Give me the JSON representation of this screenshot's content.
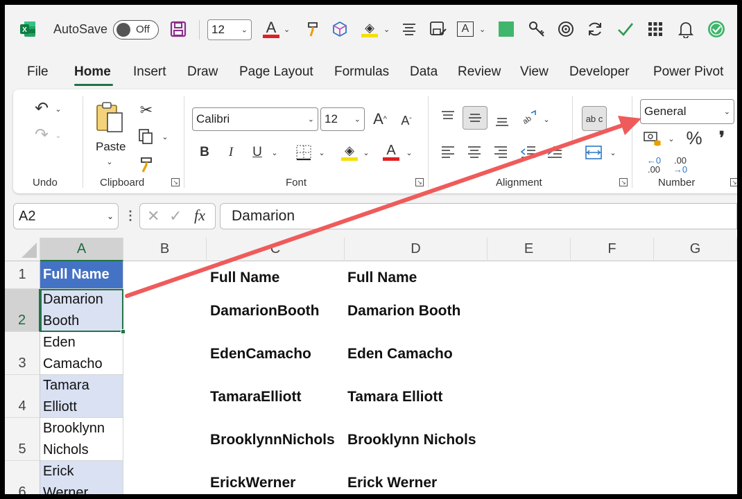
{
  "qat": {
    "autosave_label": "AutoSave",
    "autosave_state": "Off",
    "font_size": "12",
    "font_color": "#e02020",
    "highlight_color": "#f5e000"
  },
  "tabs": [
    "File",
    "Home",
    "Insert",
    "Draw",
    "Page Layout",
    "Formulas",
    "Data",
    "Review",
    "View",
    "Developer",
    "Power Pivot"
  ],
  "ribbon": {
    "groups": {
      "undo": "Undo",
      "clipboard": "Clipboard",
      "font": "Font",
      "alignment": "Alignment",
      "number": "Number"
    },
    "paste_label": "Paste",
    "font_name": "Calibri",
    "font_size": "12",
    "number_format": "General",
    "bold": "B",
    "italic": "I",
    "underline": "U",
    "percent": "%",
    "comma": "❜",
    "inc_decimal_top": "←0",
    "inc_decimal_bottom": ".00",
    "dec_decimal_top": ".00",
    "dec_decimal_bottom": "→0",
    "wrap_text": "ab c"
  },
  "formula_bar": {
    "name_box": "A2",
    "fx": "fx",
    "content": "Damarion"
  },
  "grid": {
    "columns": [
      "A",
      "B",
      "C",
      "D",
      "E",
      "F",
      "G"
    ],
    "rows": [
      "1",
      "2",
      "3",
      "4",
      "5",
      "6"
    ],
    "colA": {
      "header": "Full Name",
      "cells": [
        [
          "Damarion",
          "Booth"
        ],
        [
          "Eden",
          "Camacho"
        ],
        [
          "Tamara",
          "Elliott"
        ],
        [
          "Brooklynn",
          "Nichols"
        ],
        [
          "Erick",
          "Werner"
        ]
      ]
    },
    "colC_header": "Full Name",
    "colD_header": "Full Name",
    "colC": [
      "DamarionBooth",
      "EdenCamacho",
      "TamaraElliott",
      "BrooklynnNichols",
      "ErickWerner"
    ],
    "colD": [
      "Damarion Booth",
      "Eden Camacho",
      "Tamara Elliott",
      "Brooklynn Nichols",
      "Erick Werner"
    ]
  },
  "colors": {
    "accent": "#217346",
    "header_fill": "#4472c4",
    "band_fill": "#d9e1f2",
    "arrow": "#ef5b5b"
  }
}
